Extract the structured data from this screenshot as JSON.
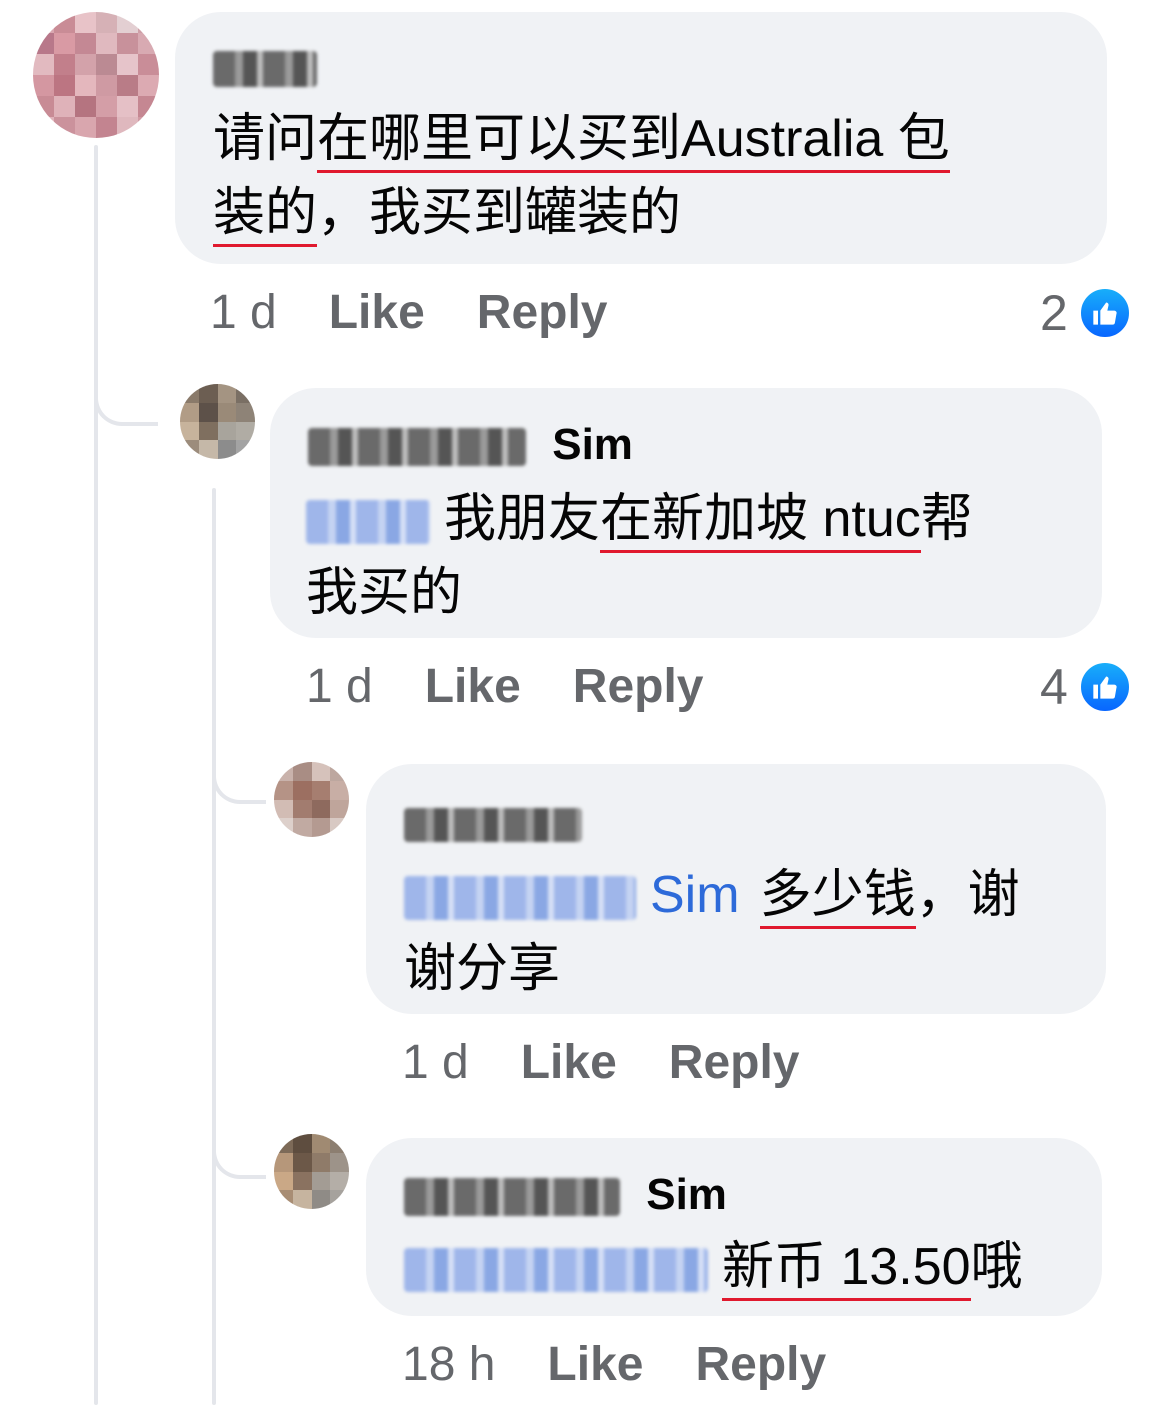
{
  "comments": [
    {
      "author_visible": "",
      "text_parts": [
        {
          "t": "请问",
          "style": "plain"
        },
        {
          "t": "在哪里可以买到Australia 包",
          "style": "underline"
        },
        {
          "t": "",
          "style": "linebreak"
        },
        {
          "t": "装的",
          "style": "underline"
        },
        {
          "t": "，我买到罐装的",
          "style": "plain"
        }
      ],
      "time": "1 d",
      "like": "Like",
      "reply": "Reply",
      "reactions": "2"
    },
    {
      "author_visible": "Sim",
      "text_parts": [
        {
          "t": "我朋友",
          "style": "plain"
        },
        {
          "t": "在新加坡 ntuc",
          "style": "underline"
        },
        {
          "t": "帮",
          "style": "plain"
        },
        {
          "t": "",
          "style": "linebreak"
        },
        {
          "t": "我买的",
          "style": "plain"
        }
      ],
      "time": "1 d",
      "like": "Like",
      "reply": "Reply",
      "reactions": "4"
    },
    {
      "author_visible": "",
      "mention_visible": "Sim",
      "text_parts": [
        {
          "t": "多少钱",
          "style": "underline"
        },
        {
          "t": "，谢",
          "style": "plain"
        },
        {
          "t": "",
          "style": "linebreak"
        },
        {
          "t": "谢分享",
          "style": "plain"
        }
      ],
      "time": "1 d",
      "like": "Like",
      "reply": "Reply"
    },
    {
      "author_visible": "Sim",
      "text_parts": [
        {
          "t": "新币 13.50",
          "style": "underline"
        },
        {
          "t": "哦",
          "style": "plain"
        }
      ],
      "time": "18 h",
      "like": "Like",
      "reply": "Reply"
    }
  ],
  "colors": {
    "bubble": "#f0f2f5",
    "mention": "#2d6ad9",
    "meta": "#65676b",
    "underline": "#e0192e",
    "like_badge": "#0866ff"
  },
  "icons": {
    "reaction": "thumbs-up-icon"
  }
}
